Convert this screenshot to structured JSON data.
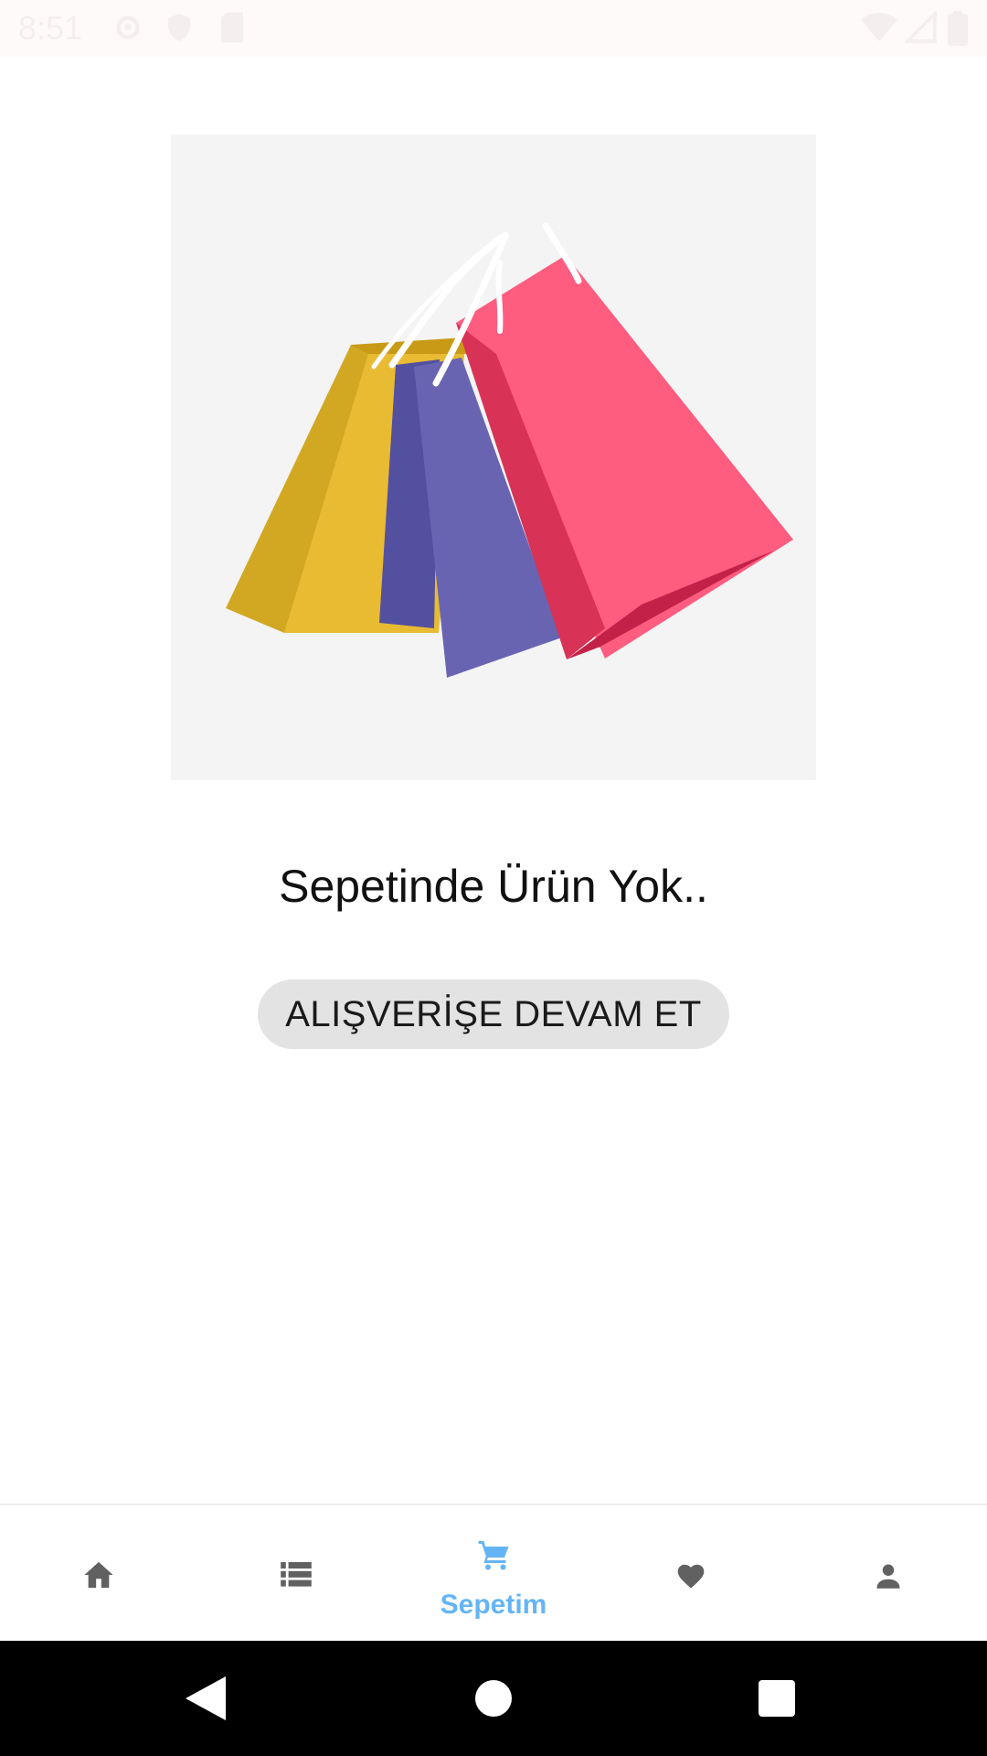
{
  "status_bar": {
    "time": "8:51",
    "icons": [
      "settings-icon",
      "shield-icon",
      "sd-card-icon",
      "wifi-icon",
      "signal-icon",
      "battery-icon"
    ]
  },
  "empty_cart": {
    "title": "Sepetinde Ürün Yok..",
    "button_label": "ALIŞVERİŞE DEVAM ET"
  },
  "bottom_nav": {
    "items": [
      {
        "icon": "home-icon",
        "label": ""
      },
      {
        "icon": "list-icon",
        "label": ""
      },
      {
        "icon": "cart-icon",
        "label": "Sepetim",
        "active": true
      },
      {
        "icon": "heart-icon",
        "label": ""
      },
      {
        "icon": "person-icon",
        "label": ""
      }
    ],
    "active_color": "#64b5f6",
    "inactive_color": "#616161"
  },
  "system_nav": {
    "buttons": [
      "back-icon",
      "home-circle-icon",
      "recents-icon"
    ]
  }
}
